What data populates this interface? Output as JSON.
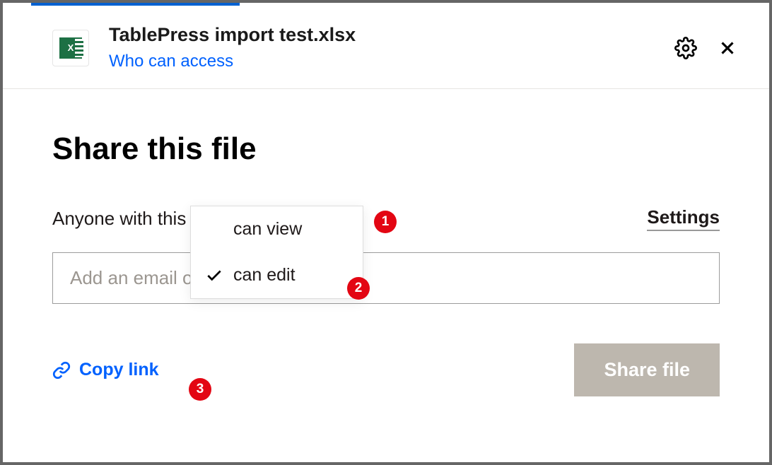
{
  "header": {
    "file_name": "TablePress import test.xlsx",
    "who_access_link": "Who can access",
    "file_icon_label": "X"
  },
  "main": {
    "title": "Share this file",
    "link_label_prefix": "Anyone with this link:",
    "permission_selected": "can edit",
    "settings_label": "Settings",
    "email_placeholder": "Add an email or name"
  },
  "dropdown": {
    "options": [
      {
        "label": "can view",
        "selected": false
      },
      {
        "label": "can edit",
        "selected": true
      }
    ]
  },
  "footer": {
    "copy_link_label": "Copy link",
    "share_button_label": "Share file"
  },
  "badges": {
    "b1": "1",
    "b2": "2",
    "b3": "3"
  },
  "colors": {
    "link_blue": "#0061fe",
    "badge_red": "#e30613",
    "excel_green": "#1d7044",
    "share_btn_bg": "#bdb7ae"
  }
}
